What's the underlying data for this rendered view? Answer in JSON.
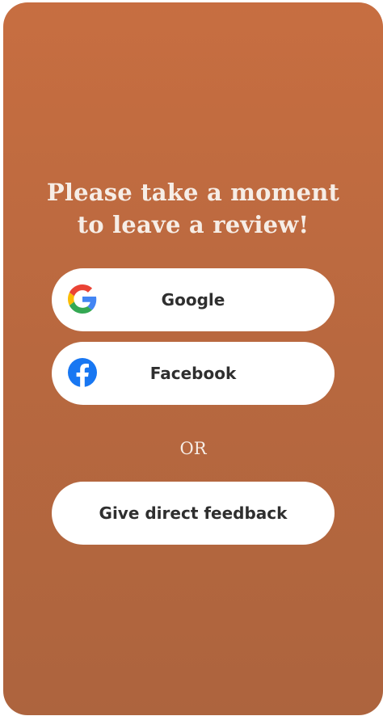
{
  "review_prompt": {
    "headline_line1": "Please take a moment",
    "headline_line2": "to leave a review!"
  },
  "buttons": {
    "google_label": "Google",
    "facebook_label": "Facebook",
    "feedback_label": "Give direct feedback"
  },
  "separator": {
    "or_text": "OR"
  },
  "icons": {
    "google": "google-logo-icon",
    "facebook": "facebook-logo-icon"
  },
  "colors": {
    "card_top": "#c76e41",
    "card_bottom": "#ad643e",
    "button_bg": "#ffffff",
    "button_text": "#2f2f2f",
    "headline_text": "#f6ede6",
    "facebook_blue": "#1877f2"
  }
}
